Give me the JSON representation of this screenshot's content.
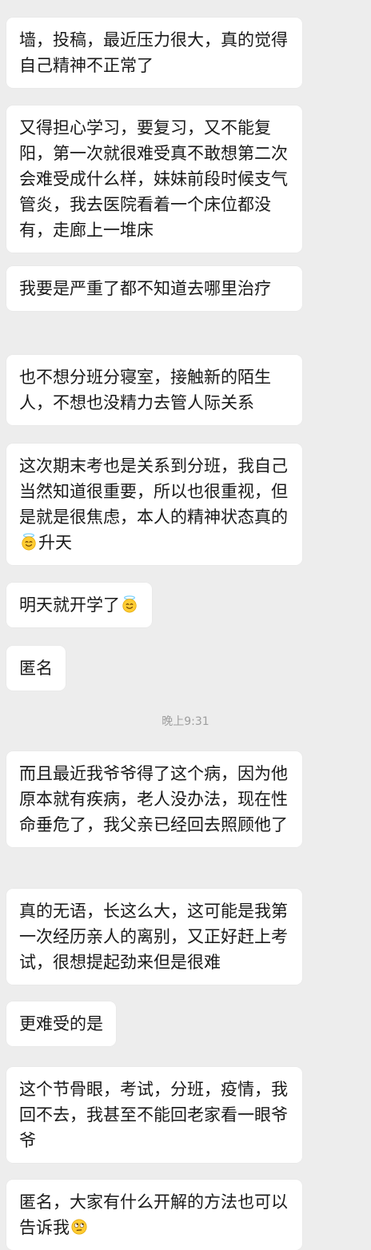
{
  "messages": [
    {
      "text": "墙，投稿，最近压力很大，真的觉得自己精神不正常了"
    },
    {
      "text": "又得担心学习，要复习，又不能复阳，第一次就很难受真不敢想第二次会难受成什么样，妹妹前段时候支气管炎，我去医院看着一个床位都没有，走廊上一堆床"
    },
    {
      "text": "我要是严重了都不知道去哪里治疗"
    },
    {
      "text": "也不想分班分寝室，接触新的陌生人，不想也没精力去管人际关系"
    },
    {
      "text_before": "这次期末考也是关系到分班，我自己当然知道很重要，所以也很重视，但是就是很焦虑，本人的精神状态真的",
      "emoji": "smiling-face-with-halo",
      "text_after": "升天"
    },
    {
      "text_before": "明天就开学了",
      "emoji": "smiling-face-with-halo"
    },
    {
      "text": "匿名"
    },
    {
      "text": "而且最近我爷爷得了这个病，因为他原本就有疾病，老人没办法，现在性命垂危了，我父亲已经回去照顾他了"
    },
    {
      "text": "真的无语，长这么大，这可能是我第一次经历亲人的离别，又正好赶上考试，很想提起劲来但是很难"
    },
    {
      "text": "更难受的是"
    },
    {
      "text": "这个节骨眼，考试，分班，疫情，我回不去，我甚至不能回老家看一眼爷爷"
    },
    {
      "text_before": "匿名，大家有什么开解的方法也可以告诉我",
      "emoji": "face-with-rolling-eyes"
    }
  ],
  "timestamp": "晚上9:31",
  "colors": {
    "background": "#ededed",
    "bubble": "#ffffff",
    "text": "#191919",
    "timestamp": "#9e9e9e",
    "emoji_yellow": "#ffcc33"
  }
}
